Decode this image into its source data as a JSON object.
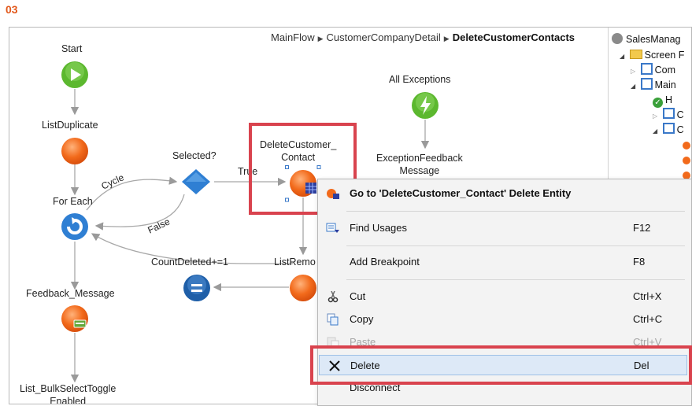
{
  "step_label": "03",
  "breadcrumb": [
    "MainFlow",
    "CustomerCompanyDetail",
    "DeleteCustomerContacts"
  ],
  "nodes": {
    "start": "Start",
    "list_duplicate": "ListDuplicate",
    "for_each": "For Each",
    "feedback_message": "Feedback_Message",
    "list_bulk_toggle_1": "List_BulkSelectToggle",
    "list_bulk_toggle_2": "Enabled",
    "selected": "Selected?",
    "delete_contact_1": "DeleteCustomer_",
    "delete_contact_2": "Contact",
    "all_exceptions": "All Exceptions",
    "exception_feedback_1": "ExceptionFeedback",
    "exception_feedback_2": "Message",
    "count_deleted": "CountDeleted+=1",
    "list_remove": "ListRemo"
  },
  "edges": {
    "cycle": "Cycle",
    "true_label": "True",
    "false_label": "False"
  },
  "tree": {
    "root": "SalesManag",
    "screen_flows": "Screen F",
    "common": "Com",
    "main": "Main",
    "h": "H",
    "c1": "C",
    "c2": "C"
  },
  "context_menu": {
    "goto": {
      "label": "Go to 'DeleteCustomer_Contact' Delete Entity",
      "shortcut": ""
    },
    "find_usages": {
      "label": "Find Usages",
      "shortcut": "F12"
    },
    "add_breakpoint": {
      "label": "Add Breakpoint",
      "shortcut": "F8"
    },
    "cut": {
      "label": "Cut",
      "shortcut": "Ctrl+X"
    },
    "copy": {
      "label": "Copy",
      "shortcut": "Ctrl+C"
    },
    "paste": {
      "label": "Paste",
      "shortcut": "Ctrl+V"
    },
    "delete": {
      "label": "Delete",
      "shortcut": "Del"
    },
    "disconnect": {
      "label": "Disconnect",
      "shortcut": ""
    }
  },
  "colors": {
    "step_label": "#e2581b",
    "highlight_box": "#d9434e",
    "start_node": "#5cb82f",
    "action_node": "#f26a1b",
    "decision_node": "#2f7fd3",
    "assign_node": "#1f5fa8",
    "menu_hover": "#dde9f7"
  }
}
